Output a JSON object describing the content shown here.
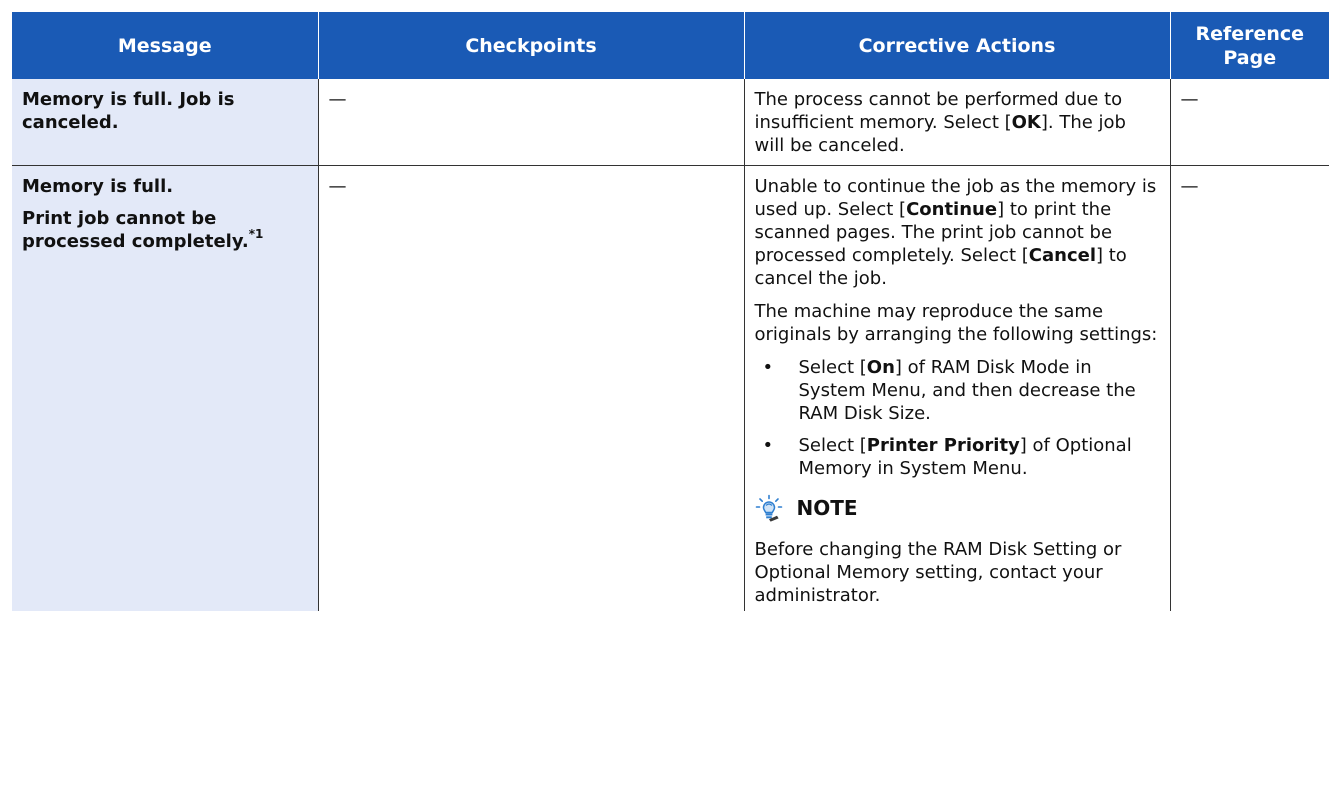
{
  "headers": {
    "message": "Message",
    "checkpoints": "Checkpoints",
    "corrective": "Corrective Actions",
    "reference_line1": "Reference",
    "reference_line2": "Page"
  },
  "rows": [
    {
      "message": "Memory is full. Job is canceled.",
      "checkpoints": "—",
      "reference": "—",
      "corrective": {
        "p1_pre": "The process cannot be performed due to insufficient memory. Select [",
        "p1_bold": "OK",
        "p1_post": "]. The job will be canceled."
      }
    },
    {
      "message_line1": "Memory is full.",
      "message_line2": "Print job cannot be processed completely.",
      "message_sup": "*1",
      "checkpoints": "—",
      "reference": "—",
      "corrective": {
        "p1_a": "Unable to continue the job as the memory is used up. Select [",
        "p1_b": "Continue",
        "p1_c": "] to print the scanned pages. The print job cannot be processed completely. Select [",
        "p1_d": "Cancel",
        "p1_e": "] to cancel the job.",
        "p2": "The machine may reproduce the same originals by arranging the following settings:",
        "bullet_char": "•",
        "bullet1_a": "Select [",
        "bullet1_b": "On",
        "bullet1_c": "] of RAM Disk Mode in System Menu, and then decrease the RAM Disk Size.",
        "bullet2_a": "Select [",
        "bullet2_b": "Printer Priority",
        "bullet2_c": "] of Optional Memory in System Menu.",
        "note_label": "NOTE",
        "note_icon": "lightbulb-note-icon",
        "note_text": "Before changing the RAM Disk Setting or Optional Memory setting, contact your administrator."
      }
    }
  ],
  "colors": {
    "header_bg": "#1a5ab5",
    "message_col_bg": "#e3e9f8",
    "note_icon_color": "#2f7fd0"
  }
}
